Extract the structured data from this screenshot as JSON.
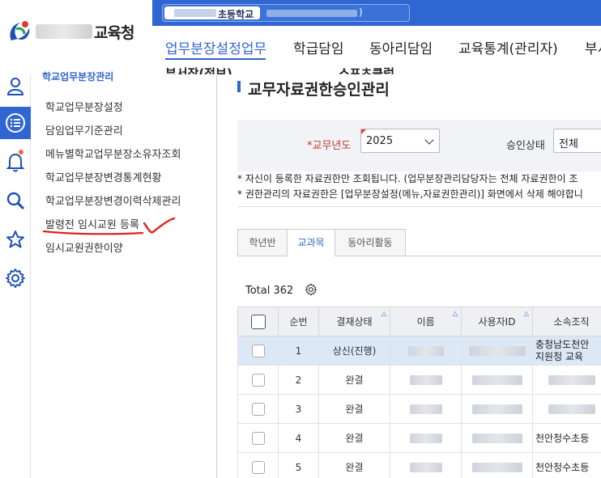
{
  "header": {
    "logo_text": "교육청",
    "school_name": "초등학교",
    "school_suffix": ")"
  },
  "gnb": {
    "items": [
      {
        "label": "업무분장설정업무"
      },
      {
        "label": "학급담임"
      },
      {
        "label": "동아리담임"
      },
      {
        "label": "교육통계(관리자)"
      },
      {
        "label": "부서"
      }
    ],
    "sub_items": [
      {
        "label": "부서장(정보)"
      },
      {
        "label": "스포츠클럽"
      }
    ]
  },
  "rail": {
    "icons": [
      "user-icon",
      "list-icon",
      "bell-icon",
      "search-icon",
      "star-icon",
      "gear-icon"
    ],
    "accent": "#2f66d1"
  },
  "submenu": {
    "title": "학교업무분장관리",
    "items": [
      {
        "label": "학교업무분장설정"
      },
      {
        "label": "담임업무기준관리"
      },
      {
        "label": "메뉴별학교업무분장소유자조회"
      },
      {
        "label": "학교업무분장변경통계현황"
      },
      {
        "label": "학교업무분장변경이력삭제관리"
      },
      {
        "label": "발령전 임시교원 등록"
      },
      {
        "label": "임시교원권한이양"
      }
    ]
  },
  "main": {
    "title": "교무자료권한승인관리",
    "search": {
      "year_label": "*교무년도",
      "year_value": "2025",
      "status_label": "승인상태",
      "status_value": "전체"
    },
    "notes": [
      "* 자신이 등록한 자료권한만 조회됩니다. (업무분장관리담당자는 전체 자료권한이 조",
      "* 권한관리의 자료권한은 [업무분장설정(메뉴,자료권한관리)] 화면에서 삭제 해야합니"
    ],
    "tabs": [
      {
        "label": "학년반"
      },
      {
        "label": "교과목"
      },
      {
        "label": "동아리활동"
      }
    ],
    "total": "Total 362",
    "columns": [
      "순번",
      "결재상태",
      "이름",
      "사용자ID",
      "소속조직"
    ],
    "rows": [
      {
        "no": "1",
        "status": "상신(진행)",
        "org_line1": "충청남도천안",
        "org_line2": "지원청 교육"
      },
      {
        "no": "2",
        "status": "완결",
        "org_line1": "",
        "org_line2": ""
      },
      {
        "no": "3",
        "status": "완결",
        "org_line1": "",
        "org_line2": ""
      },
      {
        "no": "4",
        "status": "완결",
        "org_line1": "천안청수초등",
        "org_line2": ""
      },
      {
        "no": "5",
        "status": "완결",
        "org_line1": "천안청수초등",
        "org_line2": ""
      }
    ]
  }
}
